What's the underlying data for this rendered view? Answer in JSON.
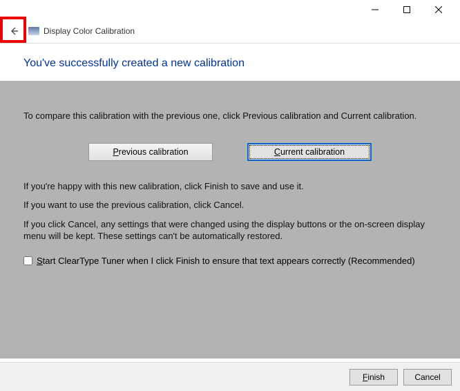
{
  "window": {
    "title": "Display Color Calibration"
  },
  "headline": "You've successfully created a new calibration",
  "content": {
    "compare_text": "To compare this calibration with the previous one, click Previous calibration and Current calibration.",
    "prev_btn": "Previous calibration",
    "curr_btn": "Current calibration",
    "happy_text": "If you're happy with this new calibration, click Finish to save and use it.",
    "prev_use_text": "If you want to use the previous calibration, click Cancel.",
    "cancel_note": "If you click Cancel, any settings that were changed using the display buttons or the on-screen display menu will be kept. These settings can't be automatically restored.",
    "cleartype_label": "Start ClearType Tuner when I click Finish to ensure that text appears correctly (Recommended)"
  },
  "footer": {
    "finish": "Finish",
    "cancel": "Cancel"
  }
}
